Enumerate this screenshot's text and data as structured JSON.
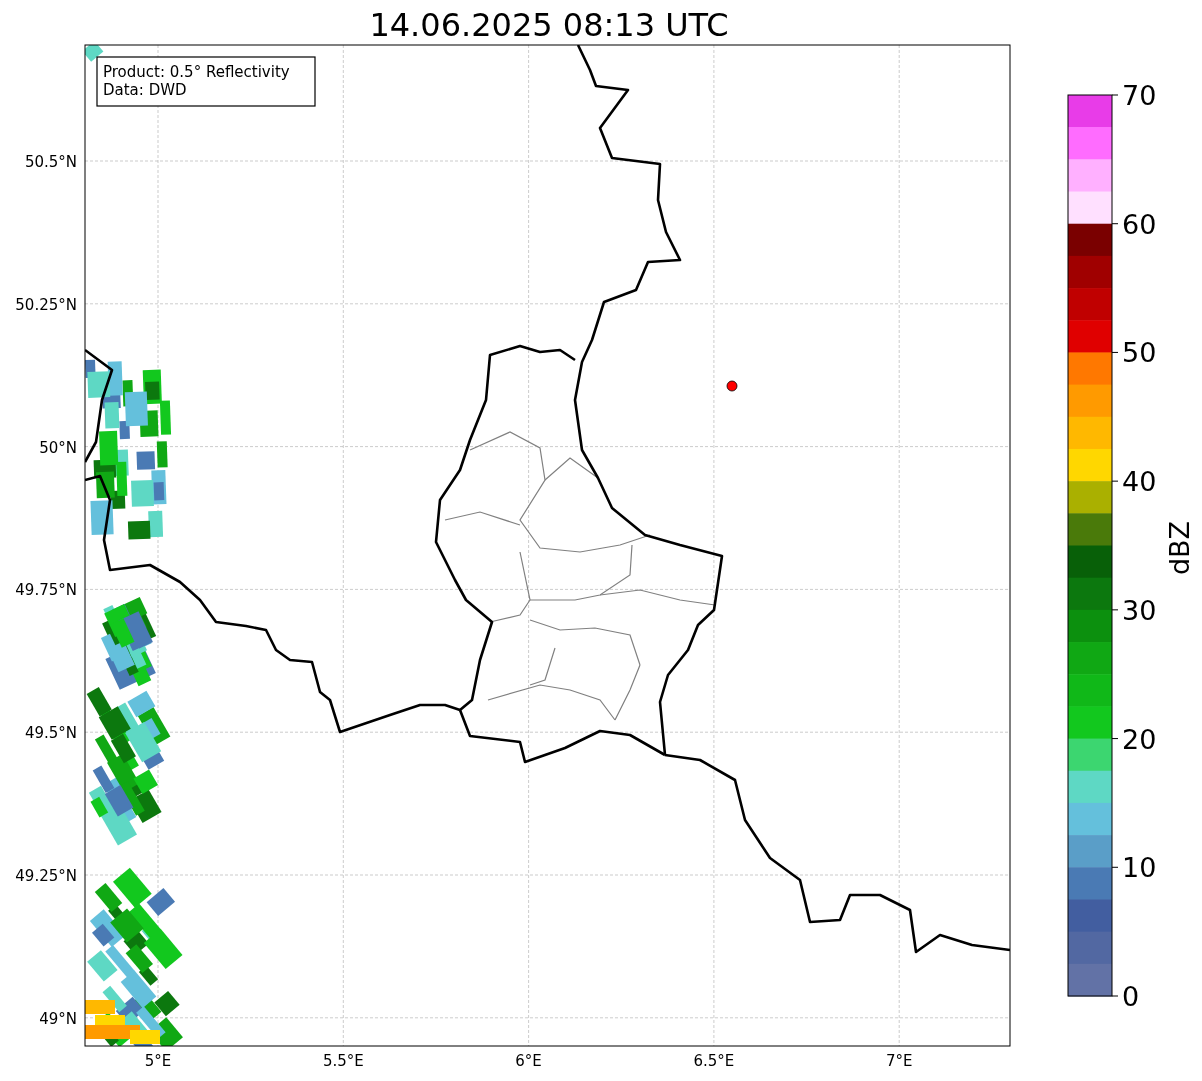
{
  "title": "14.06.2025 08:13 UTC",
  "info_box": {
    "lines": [
      "Product: 0.5° Reflectivity",
      "Data: DWD"
    ]
  },
  "y_ticks": [
    "50.5°N",
    "50.25°N",
    "50°N",
    "49.75°N",
    "49.5°N",
    "49.25°N",
    "49°N"
  ],
  "x_ticks": [
    "5°E",
    "5.5°E",
    "6°E",
    "6.5°E",
    "7°E"
  ],
  "colorbar": {
    "label": "dBZ",
    "ticks": [
      "70",
      "60",
      "50",
      "40",
      "30",
      "20",
      "10",
      "0"
    ],
    "bins": [
      {
        "color": "#e83ce8"
      },
      {
        "color": "#ff6cff"
      },
      {
        "color": "#ffb0ff"
      },
      {
        "color": "#ffe0ff"
      },
      {
        "color": "#7a0000"
      },
      {
        "color": "#a00000"
      },
      {
        "color": "#c00000"
      },
      {
        "color": "#e00000"
      },
      {
        "color": "#ff7800"
      },
      {
        "color": "#ff9a00"
      },
      {
        "color": "#ffb800"
      },
      {
        "color": "#ffd700"
      },
      {
        "color": "#aab000"
      },
      {
        "color": "#4a7a0a"
      },
      {
        "color": "#086008"
      },
      {
        "color": "#0c780e"
      },
      {
        "color": "#0c900e"
      },
      {
        "color": "#10a814"
      },
      {
        "color": "#10b818"
      },
      {
        "color": "#12c81e"
      },
      {
        "color": "#3cd670"
      },
      {
        "color": "#5ed8c4"
      },
      {
        "color": "#64c0dc"
      },
      {
        "color": "#5a9ec8"
      },
      {
        "color": "#4a7ab4"
      },
      {
        "color": "#425ea0"
      },
      {
        "color": "#5268a2"
      },
      {
        "color": "#6272a6"
      }
    ]
  }
}
